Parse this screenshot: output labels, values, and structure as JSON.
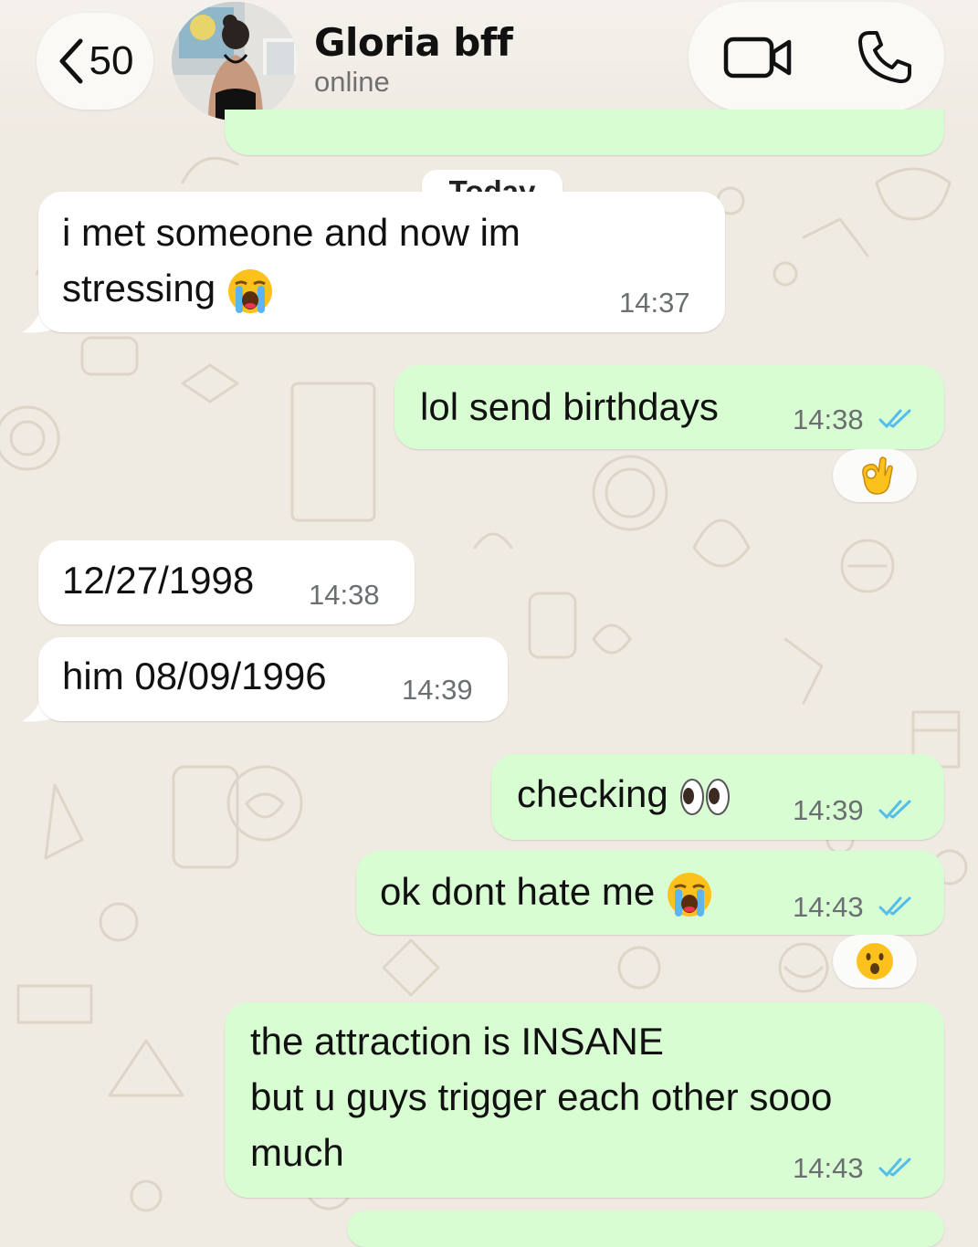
{
  "header": {
    "back_count": "50",
    "contact_name": "Gloria bff",
    "contact_status": "online"
  },
  "date_separator": "Today",
  "messages": [
    {
      "direction": "in",
      "lines": [
        "i met someone and now im",
        "stressing"
      ],
      "emoji": "loudly-crying-face",
      "time": "14:37"
    },
    {
      "direction": "out",
      "text": "lol send birthdays",
      "time": "14:38",
      "read": true,
      "reaction": "ok-hand"
    },
    {
      "direction": "in",
      "text": "12/27/1998",
      "time": "14:38"
    },
    {
      "direction": "in",
      "text": "him 08/09/1996",
      "time": "14:39"
    },
    {
      "direction": "out",
      "text": "checking",
      "emoji": "eyes",
      "time": "14:39",
      "read": true
    },
    {
      "direction": "out",
      "text": "ok dont hate me",
      "emoji": "loudly-crying-face",
      "time": "14:43",
      "read": true,
      "reaction": "hushed-face"
    },
    {
      "direction": "out",
      "lines": [
        "the attraction is INSANE",
        "but u guys trigger each other sooo",
        "much"
      ],
      "time": "14:43",
      "read": true
    }
  ],
  "colors": {
    "background": "#efeae2",
    "incoming_bubble": "#ffffff",
    "outgoing_bubble": "#d9fdd3",
    "read_ticks": "#53bdeb"
  }
}
